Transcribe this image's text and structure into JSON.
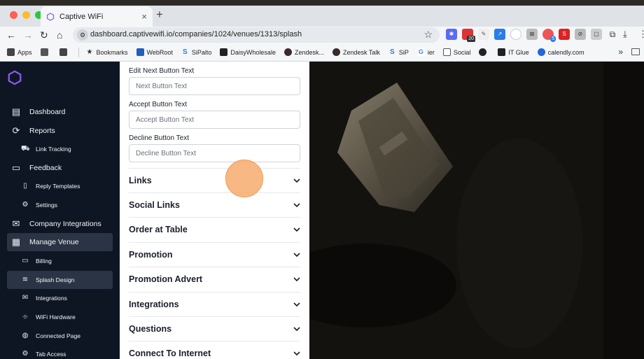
{
  "browser": {
    "tab_title": "Captive WiFi",
    "tab_close": "×",
    "new_tab": "+",
    "url": "dashboard.captivewifi.io/companies/1024/venues/1313/splash",
    "traffic_lights": [
      "#ff5f57",
      "#febc2e",
      "#28c840"
    ],
    "extension_badge": "20",
    "extension_badge_2": "5",
    "bookmarks": [
      {
        "label": "Apps",
        "icon": "apps-grid-icon",
        "color": "#444444"
      },
      {
        "label": "",
        "icon": "square-icon",
        "color": "#555555"
      },
      {
        "label": "",
        "icon": "grid-icon",
        "color": "#444444"
      },
      {
        "label": "Bookmarks",
        "icon": "star-icon",
        "color": "#333333"
      },
      {
        "label": "WebRoot",
        "icon": "webroot-icon",
        "color": "#1f5fc2"
      },
      {
        "label": "SiPalto",
        "icon": "sipalto-icon",
        "color": "#2e7bd6"
      },
      {
        "label": "DaisyWholesale",
        "icon": "daisy-icon",
        "color": "#222222"
      },
      {
        "label": "Zendesk...",
        "icon": "zendesk-icon",
        "color": "#3b2a2a"
      },
      {
        "label": "Zendesk Talk",
        "icon": "zendesk-talk-icon",
        "color": "#3b2a2a"
      },
      {
        "label": "SiP",
        "icon": "sip-icon",
        "color": "#2e7bd6"
      },
      {
        "label": "ier",
        "icon": "google-icon",
        "color": "#ffffff"
      },
      {
        "label": "Social",
        "icon": "folder-icon",
        "color": "#ffffff"
      },
      {
        "label": "",
        "icon": "github-icon",
        "color": "#222222"
      },
      {
        "label": "IT Glue",
        "icon": "itglue-icon",
        "color": "#222222"
      },
      {
        "label": "calendly.com",
        "icon": "calendly-icon",
        "color": "#2266dd"
      }
    ],
    "bookmarks_more": "»"
  },
  "sidebar": {
    "logo": "hexagon-logo-icon",
    "items": [
      {
        "label": "Dashboard",
        "icon": "chart-icon",
        "sub": false,
        "active": false
      },
      {
        "label": "Reports",
        "icon": "refresh-icon",
        "sub": false,
        "active": false
      },
      {
        "label": "Link Tracking",
        "icon": "truck-icon",
        "sub": true,
        "active": false
      },
      {
        "label": "Feedback",
        "icon": "chat-icon",
        "sub": false,
        "active": false
      },
      {
        "label": "Reply Templates",
        "icon": "document-icon",
        "sub": true,
        "active": false
      },
      {
        "label": "Settings",
        "icon": "gear-icon",
        "sub": true,
        "active": false
      },
      {
        "label": "Company Integrations",
        "icon": "mail-icon",
        "sub": false,
        "active": false
      },
      {
        "label": "Manage Venue",
        "icon": "building-icon",
        "sub": false,
        "active": true
      },
      {
        "label": "Billing",
        "icon": "card-icon",
        "sub": true,
        "active": false
      },
      {
        "label": "Splash Design",
        "icon": "wifi-icon",
        "sub": true,
        "active": true
      },
      {
        "label": "Integrations",
        "icon": "envelope-icon",
        "sub": true,
        "active": false
      },
      {
        "label": "WiFi Hardware",
        "icon": "router-icon",
        "sub": true,
        "active": false
      },
      {
        "label": "Connected Page",
        "icon": "globe-icon",
        "sub": true,
        "active": false
      },
      {
        "label": "Tab Access",
        "icon": "gear-icon",
        "sub": true,
        "active": false
      }
    ]
  },
  "panel": {
    "fields": [
      {
        "label": "Edit Next Button Text",
        "placeholder": "Next Button Text",
        "value": ""
      },
      {
        "label": "Accept Button Text",
        "placeholder": "Accept Button Text",
        "value": ""
      },
      {
        "label": "Decline Button Text",
        "placeholder": "Decline Button Text",
        "value": ""
      }
    ],
    "sections": [
      {
        "title": "Links"
      },
      {
        "title": "Social Links"
      },
      {
        "title": "Order at Table"
      },
      {
        "title": "Promotion"
      },
      {
        "title": "Promotion Advert"
      },
      {
        "title": "Integrations"
      },
      {
        "title": "Questions"
      },
      {
        "title": "Connect To Internet"
      }
    ]
  },
  "colors": {
    "sidebar_bg": "#0f1623",
    "accent_purple": "#8b5cf6",
    "click_highlight": "#f7ac6e"
  }
}
